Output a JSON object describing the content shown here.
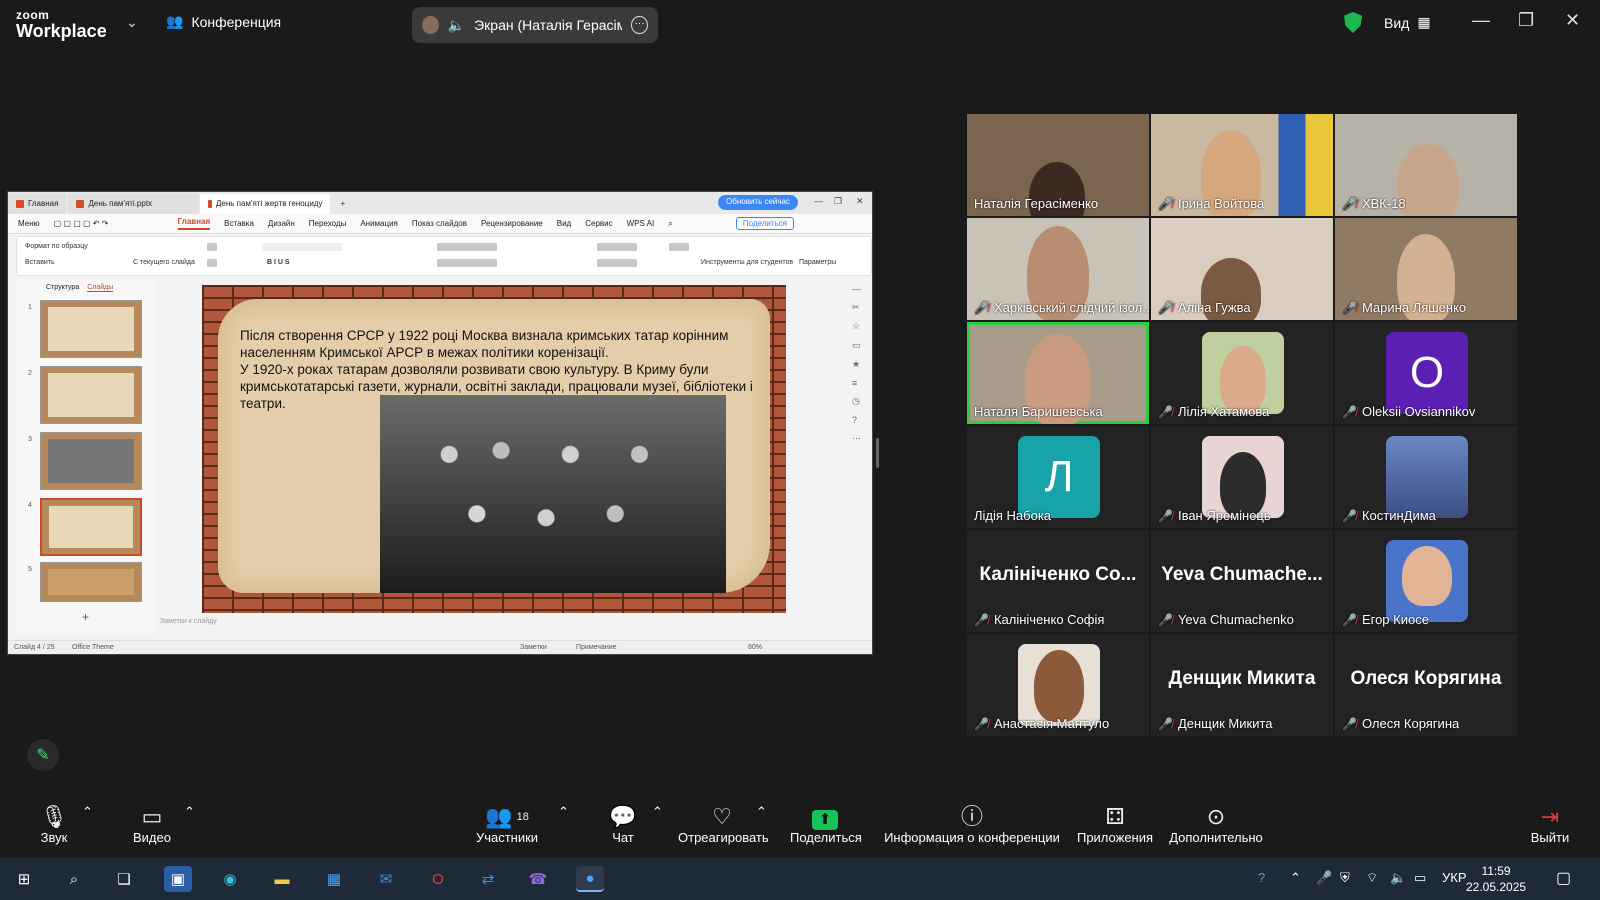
{
  "window": {
    "logo_top": "zoom",
    "logo_bottom": "Workplace",
    "conference_label": "Конференция",
    "screen_label": "Экран (Наталія Герасіменко)",
    "view_label": "Вид"
  },
  "shared_screen": {
    "tabs": [
      "Главная",
      "День пам'яті.pptx",
      "День пам'яті жертв геноциду"
    ],
    "update_button": "Обновить сейчас",
    "menu": [
      "Меню",
      "Главная",
      "Вставка",
      "Дизайн",
      "Переходы",
      "Анимация",
      "Показ слайдов",
      "Рецензирование",
      "Вид",
      "Сервис",
      "WPS AI"
    ],
    "share_button": "Поделиться",
    "ribbon": {
      "format_painter": "Формат по образцу",
      "paste": "Вставить",
      "from_current": "С текущего слайда",
      "student_tools": "Инструменты для студентов",
      "params": "Параметры"
    },
    "panel_tabs": [
      "Структура",
      "Слайды"
    ],
    "slide_numbers": [
      "1",
      "2",
      "3",
      "4",
      "5"
    ],
    "slide_text_1": "Після створення СРСР у 1922 році Москва визнала кримських татар корінним населенням Кримської АРСР в межах політики коренізації.",
    "slide_text_2": "У 1920-х роках татарам дозволяли розвивати свою культуру. В Криму були кримськотатарські газети, журнали, освітні заклади, працювали музеї, бібліотеки і театри.",
    "notes_placeholder": "Заметки к слайду",
    "status": {
      "slide_count": "Слайд 4 / 25",
      "theme": "Office Theme",
      "notes": "Заметки",
      "comment": "Примечание",
      "zoom": "80%"
    }
  },
  "participants": [
    {
      "name": "Наталія Герасіменко",
      "muted": false,
      "kind": "video"
    },
    {
      "name": "Ірина Войтова",
      "muted": true,
      "kind": "video"
    },
    {
      "name": "ХВК-18",
      "muted": true,
      "kind": "video"
    },
    {
      "name": "Харківський слідчий ізол...",
      "muted": true,
      "kind": "video"
    },
    {
      "name": "Аліна Гужва",
      "muted": true,
      "kind": "video"
    },
    {
      "name": "Марина Ляшенко",
      "muted": true,
      "kind": "video"
    },
    {
      "name": "Наталя Баришевська",
      "muted": false,
      "kind": "video",
      "speaking": true
    },
    {
      "name": "Лілія Хатамова",
      "muted": true,
      "kind": "photo"
    },
    {
      "name": "Oleksii Ovsiannikov",
      "muted": true,
      "kind": "letter",
      "letter": "O",
      "color": "#5b1fb3"
    },
    {
      "name": "Лідія Набока",
      "muted": false,
      "kind": "letter",
      "letter": "Л",
      "color": "#17a3a8"
    },
    {
      "name": "Іван Яремінець",
      "muted": true,
      "kind": "photo"
    },
    {
      "name": "КостинДима",
      "muted": true,
      "kind": "photo"
    },
    {
      "name": "Калініченко Софія",
      "muted": true,
      "kind": "text",
      "big": "Калініченко Со..."
    },
    {
      "name": "Yeva Chumachenko",
      "muted": true,
      "kind": "text",
      "big": "Yeva  Chumache..."
    },
    {
      "name": "Егор Киосе",
      "muted": true,
      "kind": "photo"
    },
    {
      "name": "Анастасія Мантуло",
      "muted": true,
      "kind": "photo"
    },
    {
      "name": "Денщик Микита",
      "muted": true,
      "kind": "text",
      "big": "Денщик Микита"
    },
    {
      "name": "Олеся Корягина",
      "muted": true,
      "kind": "text",
      "big": "Олеся Корягина"
    }
  ],
  "toolbar": {
    "audio": "Звук",
    "video": "Видео",
    "participants": "Участники",
    "participants_count": "18",
    "chat": "Чат",
    "react": "Отреагировать",
    "share": "Поделиться",
    "info": "Информация о конференции",
    "apps": "Приложения",
    "more": "Дополнительно",
    "leave": "Выйти"
  },
  "taskbar": {
    "lang": "УКР",
    "time": "11:59",
    "date": "22.05.2025"
  },
  "colors": {
    "background": "#1a1a1a",
    "speaker_border": "#2ecc40",
    "muted_red": "#e53935",
    "share_green": "#15c35a"
  }
}
